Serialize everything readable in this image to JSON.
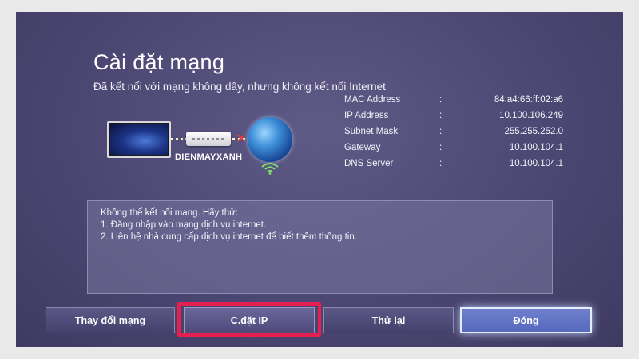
{
  "dialog": {
    "title": "Cài đặt mạng",
    "status": "Đã kết nối với mạng không dây, nhưng không kết nối Internet"
  },
  "illustration": {
    "brand": "DIENMAYXANH",
    "icons": [
      "tv-icon",
      "router-icon",
      "disconnected-icon",
      "globe-icon",
      "wifi-icon"
    ]
  },
  "network_info": [
    {
      "label": "MAC Address",
      "value": "84:a4:66:ff:02:a6"
    },
    {
      "label": "IP Address",
      "value": "10.100.106.249"
    },
    {
      "label": "Subnet Mask",
      "value": "255.255.252.0"
    },
    {
      "label": "Gateway",
      "value": "10.100.104.1"
    },
    {
      "label": "DNS Server",
      "value": "10.100.104.1"
    }
  ],
  "separator": ":",
  "message": {
    "lines": [
      "Không thể kết nối mạng. Hãy thử:",
      "1. Đăng nhập vào mạng dịch vụ internet.",
      "2. Liên hệ nhà cung cấp dịch vụ internet để biết thêm thông tin."
    ]
  },
  "buttons": {
    "change_network": "Thay đổi mạng",
    "ip_settings": "C.đặt IP",
    "retry": "Thử lại",
    "close": "Đóng"
  },
  "colors": {
    "highlight": "#e51f4f",
    "focus": "#5569be"
  }
}
